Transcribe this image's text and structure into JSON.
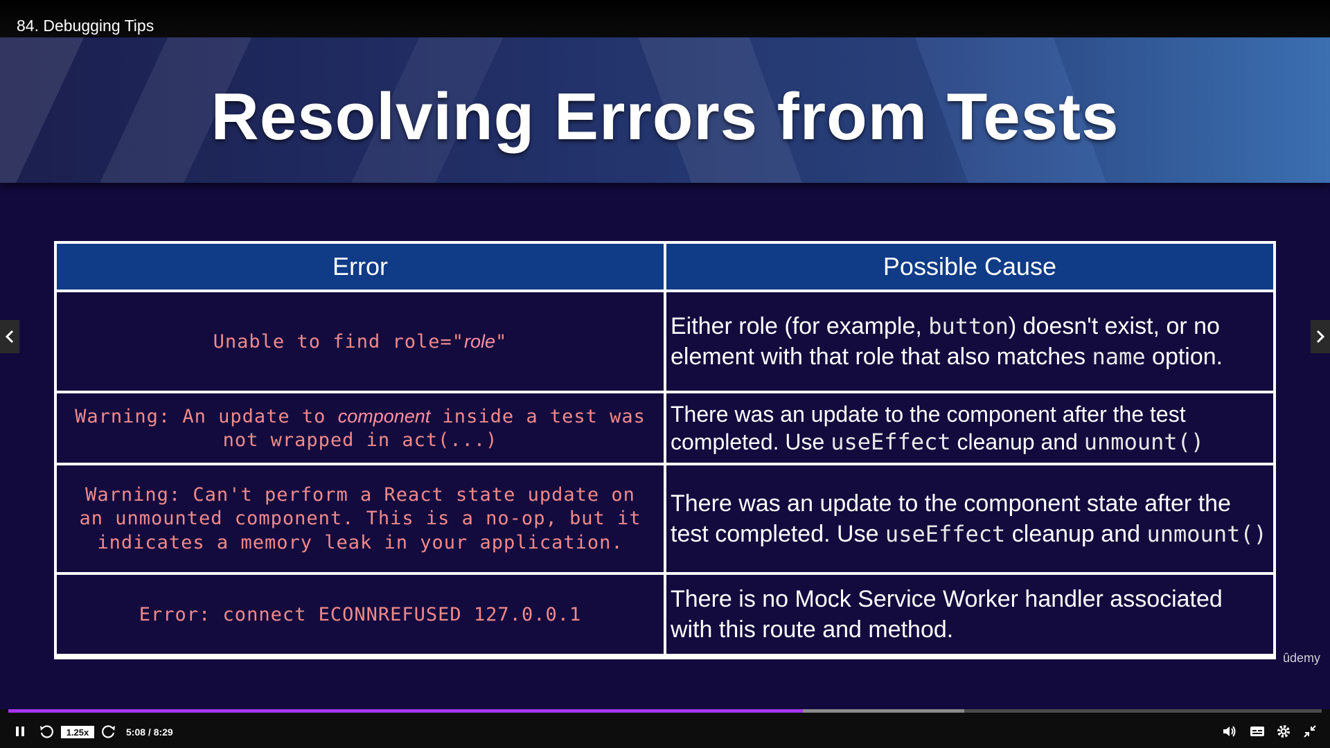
{
  "header": {
    "lecture_title": "84. Debugging Tips"
  },
  "slide": {
    "title": "Resolving Errors from Tests",
    "table": {
      "headers": [
        "Error",
        "Possible Cause"
      ],
      "rows": [
        {
          "error_pre": "Unable to find role=\"",
          "error_em": "role",
          "error_post": "\"",
          "cause": [
            {
              "t": "Either role (for example, "
            },
            {
              "c": "button"
            },
            {
              "t": ") doesn't exist, or no element with that role that also matches "
            },
            {
              "c": "name"
            },
            {
              "t": " option."
            }
          ]
        },
        {
          "error_pre": "Warning: An update to ",
          "error_em": "component",
          "error_post": " inside a test was not wrapped in act(...)",
          "cause": [
            {
              "t": "There was an update to the component after the test completed. Use "
            },
            {
              "c": "useEffect"
            },
            {
              "t": " cleanup and "
            },
            {
              "c": "unmount()"
            }
          ]
        },
        {
          "error_pre": "Warning: Can't perform a React state update on an unmounted component. This is a no-op, but it indicates a memory leak in your application.",
          "error_em": "",
          "error_post": "",
          "cause": [
            {
              "t": "There was an update to the component state after the test completed. Use "
            },
            {
              "c": "useEffect"
            },
            {
              "t": " cleanup and "
            },
            {
              "c": "unmount()"
            }
          ]
        },
        {
          "error_pre": "Error: connect ECONNREFUSED 127.0.0.1",
          "error_em": "",
          "error_post": "",
          "cause": [
            {
              "t": "There is no Mock Service Worker handler associated with this route and method."
            }
          ]
        }
      ]
    },
    "watermark": "ûdemy"
  },
  "player": {
    "speed_label": "1.25x",
    "time_label": "5:08 / 8:29",
    "progress_played": 0.605,
    "progress_buffered": 0.728,
    "accent_color": "#a435f0",
    "icons": [
      "pause-icon",
      "rewind-icon",
      "forward-icon",
      "volume-icon",
      "captions-icon",
      "settings-icon",
      "exit-fullscreen-icon",
      "prev-arrow-icon",
      "next-arrow-icon"
    ]
  }
}
